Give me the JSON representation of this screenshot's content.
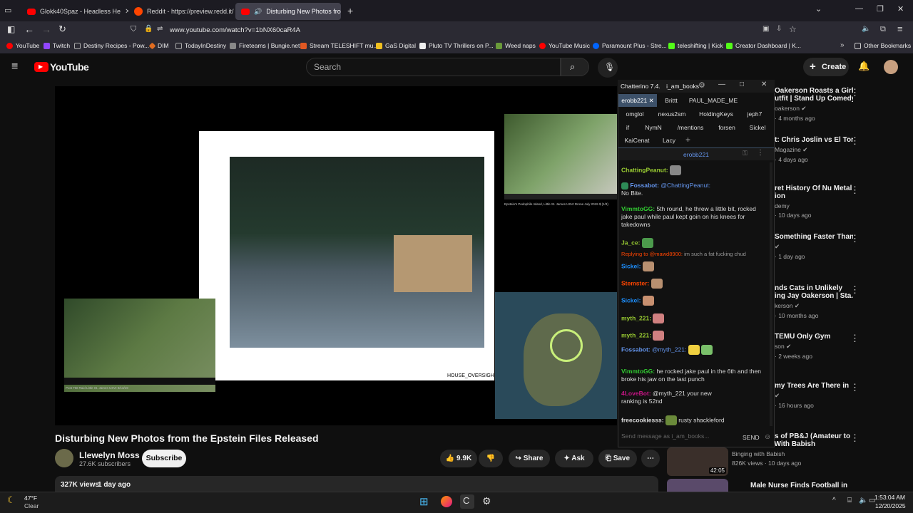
{
  "tabs": [
    {
      "label": "Glokk40Spaz - Headless He"
    },
    {
      "label": "Reddit - https://preview.redd.it/"
    },
    {
      "label": "Disturbing New Photos fron"
    }
  ],
  "url": "www.youtube.com/watch?v=1bNX60caR4A",
  "bookmarks": [
    "YouTube",
    "Twitch",
    "Destiny Recipes - Pow...",
    "DIM",
    "TodayInDestiny",
    "Fireteams | Bungie.net",
    "Stream TELESHIFT mu...",
    "GaS Digital",
    "Pluto TV Thrillers on P...",
    "Weed naps",
    "YouTube Music",
    "Paramount Plus - Stre...",
    "teleshifting | Kick",
    "Creator Dashboard | K...",
    "Other Bookmarks"
  ],
  "yt": {
    "logo": "YouTube",
    "search_placeholder": "Search",
    "create": "Create"
  },
  "video": {
    "title": "Disturbing New Photos from the Epstein Files Released",
    "channel": "Llewelyn Moss",
    "subscribers": "27.6K subscribers",
    "subscribe": "Subscribe",
    "likes": "9.9K",
    "share": "Share",
    "ask": "Ask",
    "save": "Save",
    "views": "327K views",
    "date": "1 day ago",
    "slide_caption": "HOUSE_OVERSIGHT_",
    "photo2_caption": "Epstein's Pedophile Island, Little St. James USVI Drone July 2019 $ (1/3)",
    "photo3_caption": "Post FBI Raid Little St. James USVI 8/13/19"
  },
  "recommended": [
    {
      "title": "Oakerson Roasts a Girl's",
      "title2": "utfit | Stand Up Comedy",
      "meta": "oakerson",
      "meta2": "· 4 months ago"
    },
    {
      "title": "t: Chris Joslin vs El Toro",
      "meta": "Magazine",
      "meta2": "· 4 days ago"
    },
    {
      "title": "ret History Of Nu Metal",
      "title2": "ion",
      "meta": "demy",
      "meta2": "· 10 days ago"
    },
    {
      "title": "Something Faster Than",
      "meta": "",
      "meta2": "· 1 day ago"
    },
    {
      "title": "nds Cats in Unlikely",
      "title2": "ing Jay Oakerson | Sta...",
      "meta": "kerson",
      "meta2": "· 10 months ago"
    },
    {
      "title": "TEMU Only Gym",
      "meta": "son",
      "meta2": "· 2 weeks ago"
    },
    {
      "title": "my Trees Are There in",
      "meta": "",
      "meta2": "· 16 hours ago"
    },
    {
      "title": "s of PB&J (Amateur to",
      "title2": "Advanced) | With Babish",
      "meta": "Binging with Babish",
      "meta2": "826K views · 10 days ago",
      "duration": "42:05"
    },
    {
      "title": "Male Nurse Finds Football in"
    }
  ],
  "chatterino": {
    "title": "Chatterino 7.4.",
    "user": "i_am_books",
    "tabs_row1": [
      "erobb221",
      "Brittt",
      "PAUL_MADE_ME"
    ],
    "tabs_row2": [
      "omglol",
      "nexus2sm",
      "HoldingKeys",
      "jeph7"
    ],
    "tabs_row3": [
      "if",
      "NymN",
      "/mentions",
      "forsen",
      "Sickel"
    ],
    "tabs_row4": [
      "KaiCenat",
      "Lacy"
    ],
    "channel": "erobb221",
    "messages": [
      {
        "name": "ChattingPeanut:",
        "text": "",
        "color": "#9acd32"
      },
      {
        "name": "Fossabot:",
        "text": "@ChattingPeanut:",
        "color": "#6495ed",
        "extra": "No Bite."
      },
      {
        "name": "VimmtoGG:",
        "text": "5th round, he threw a little bit, rocked jake paul while paul kept goin on his knees for takedowns",
        "color": "#32cd32"
      },
      {
        "name": "Ja_ce:",
        "text": "",
        "color": "#9acd32"
      },
      {
        "name": "Replying to @mawd8900:",
        "text": "im such a fat fucking chud",
        "color": "#ff4500"
      },
      {
        "name": "Sickel:",
        "text": "",
        "color": "#1e90ff"
      },
      {
        "name": "Stemster:",
        "text": "",
        "color": "#ff4500"
      },
      {
        "name": "Sickel:",
        "text": "",
        "color": "#1e90ff"
      },
      {
        "name": "myth_221:",
        "text": "",
        "color": "#9acd32"
      },
      {
        "name": "myth_221:",
        "text": "",
        "color": "#9acd32"
      },
      {
        "name": "Fossabot:",
        "text": "@myth_221:",
        "color": "#6495ed"
      },
      {
        "name": "VimmtoGG:",
        "text": "he rocked jake paul in the 6th and then broke his jaw on the last punch",
        "color": "#32cd32"
      },
      {
        "name": "4LoveBot:",
        "text": "@myth_221 your new",
        "color": "#c71585",
        "extra": "ranking is 52nd"
      },
      {
        "name": "freecookiesss:",
        "text": "rusty shackleford",
        "color": "#dcdcdc"
      }
    ],
    "input_placeholder": "Send message as i_am_books...",
    "send": "SEND"
  },
  "taskbar": {
    "temp": "47°F",
    "weather": "Clear",
    "time": "1:53:04 AM",
    "date": "12/20/2025"
  }
}
